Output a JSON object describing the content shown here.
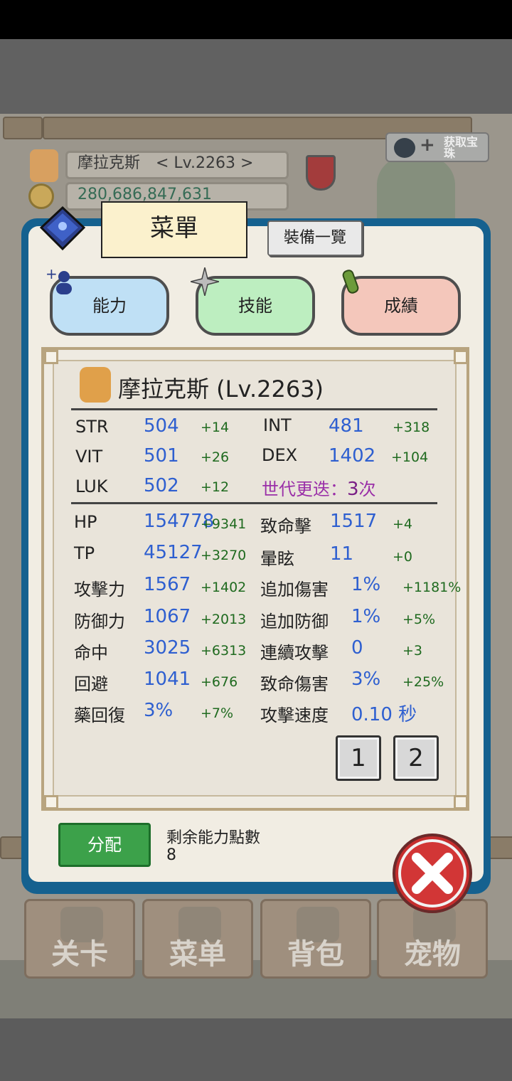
{
  "hud": {
    "player": "摩拉克斯　< Lv.2263 >",
    "gold": "280,686,847,631",
    "premium_label": "获取宝珠"
  },
  "panel": {
    "menu_title": "菜單",
    "equip_list": "裝備一覽",
    "tabs": [
      {
        "label": "能力",
        "color": "#bfe0f5"
      },
      {
        "label": "技能",
        "color": "#bdeec0"
      },
      {
        "label": "成績",
        "color": "#f4c7bb"
      }
    ]
  },
  "character": {
    "title": "摩拉克斯 (Lv.2263)"
  },
  "base_stats": [
    {
      "name": "STR",
      "value": "504",
      "bonus": "+14"
    },
    {
      "name": "INT",
      "value": "481",
      "bonus": "+318"
    },
    {
      "name": "VIT",
      "value": "501",
      "bonus": "+26"
    },
    {
      "name": "DEX",
      "value": "1402",
      "bonus": "+104"
    },
    {
      "name": "LUK",
      "value": "502",
      "bonus": "+12"
    }
  ],
  "generation": {
    "label": "世代更迭：",
    "count": "3",
    "unit": "次"
  },
  "left_stats": [
    {
      "name": "HP",
      "value": "154778",
      "bonus": "+9341"
    },
    {
      "name": "TP",
      "value": "45127",
      "bonus": "+3270"
    },
    {
      "name": "攻擊力",
      "value": "1567",
      "bonus": "+1402"
    },
    {
      "name": "防御力",
      "value": "1067",
      "bonus": "+2013"
    },
    {
      "name": "命中",
      "value": "3025",
      "bonus": "+6313"
    },
    {
      "name": "回避",
      "value": "1041",
      "bonus": "+676"
    },
    {
      "name": "藥回復",
      "value": "3%",
      "bonus": "+7%"
    }
  ],
  "right_stats": [
    {
      "name": "致命擊",
      "value": "1517",
      "bonus": "+4"
    },
    {
      "name": "暈眩",
      "value": "11",
      "bonus": "+0"
    },
    {
      "name": "追加傷害",
      "value": "1%",
      "bonus": "+1181%"
    },
    {
      "name": "追加防御",
      "value": "1%",
      "bonus": "+5%"
    },
    {
      "name": "連續攻擊",
      "value": "0",
      "bonus": "+3"
    },
    {
      "name": "致命傷害",
      "value": "3%",
      "bonus": "+25%"
    },
    {
      "name": "攻擊速度",
      "value": "0.10 秒",
      "bonus": ""
    }
  ],
  "pages": [
    "1",
    "2"
  ],
  "footer": {
    "assign": "分配",
    "remaining_label": "剩余能力點數",
    "remaining_value": "8"
  },
  "bottom_nav": [
    "关卡",
    "菜单",
    "背包",
    "宠物"
  ],
  "colors": {
    "panel_border": "#15618f",
    "stat_value": "#2e5fd0",
    "stat_bonus": "#1f6a1f",
    "generation": "#9a2fa8",
    "assign_button": "#3ca14a",
    "close_button": "#c62e2e"
  }
}
